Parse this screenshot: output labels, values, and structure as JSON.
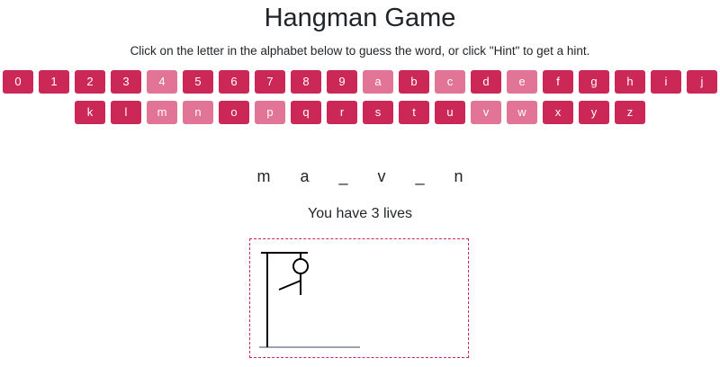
{
  "header": {
    "title": "Hangman Game",
    "instructions": "Click on the letter in the alphabet below to guess the word, or click \"Hint\" to get a hint."
  },
  "keyboard": {
    "row1": [
      {
        "label": "0",
        "used": false
      },
      {
        "label": "1",
        "used": false
      },
      {
        "label": "2",
        "used": false
      },
      {
        "label": "3",
        "used": false
      },
      {
        "label": "4",
        "used": true
      },
      {
        "label": "5",
        "used": false
      },
      {
        "label": "6",
        "used": false
      },
      {
        "label": "7",
        "used": false
      },
      {
        "label": "8",
        "used": false
      },
      {
        "label": "9",
        "used": false
      },
      {
        "label": "a",
        "used": true
      },
      {
        "label": "b",
        "used": false
      },
      {
        "label": "c",
        "used": true
      },
      {
        "label": "d",
        "used": false
      },
      {
        "label": "e",
        "used": true
      },
      {
        "label": "f",
        "used": false
      },
      {
        "label": "g",
        "used": false
      },
      {
        "label": "h",
        "used": false
      },
      {
        "label": "i",
        "used": false
      },
      {
        "label": "j",
        "used": false
      }
    ],
    "row2": [
      {
        "label": "k",
        "used": false
      },
      {
        "label": "l",
        "used": false
      },
      {
        "label": "m",
        "used": true
      },
      {
        "label": "n",
        "used": true
      },
      {
        "label": "o",
        "used": false
      },
      {
        "label": "p",
        "used": true
      },
      {
        "label": "q",
        "used": false
      },
      {
        "label": "r",
        "used": false
      },
      {
        "label": "s",
        "used": false
      },
      {
        "label": "t",
        "used": false
      },
      {
        "label": "u",
        "used": false
      },
      {
        "label": "v",
        "used": true
      },
      {
        "label": "w",
        "used": true
      },
      {
        "label": "x",
        "used": false
      },
      {
        "label": "y",
        "used": false
      },
      {
        "label": "z",
        "used": false
      }
    ]
  },
  "game": {
    "word_display": "m a _ v _ n",
    "lives_text": "You have 3 lives"
  },
  "colors": {
    "key": "#cc2857",
    "key_used": "#e27497",
    "drawing": "#000000",
    "ground": "#9aa5b1"
  }
}
